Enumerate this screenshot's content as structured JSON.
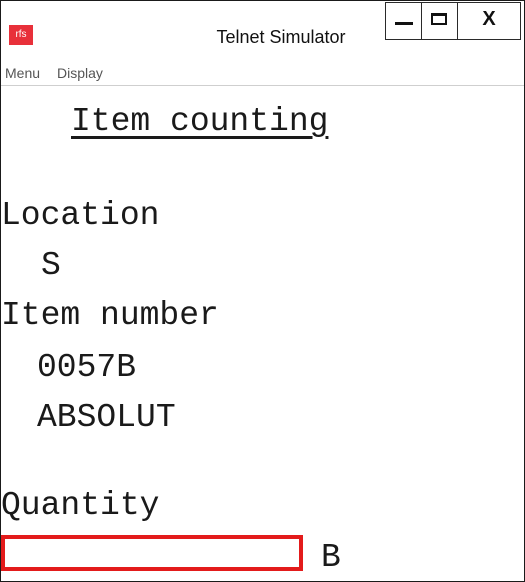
{
  "window": {
    "app_icon_label": "rfs",
    "title": "Telnet Simulator",
    "controls": {
      "minimize": "minimize",
      "maximize": "maximize",
      "close_label": "X"
    }
  },
  "menu": {
    "items": [
      "Menu",
      "Display"
    ]
  },
  "screen": {
    "heading": "Item counting",
    "location_label": "Location",
    "location_value": "S",
    "item_number_label": "Item number",
    "item_number_value": "0057B",
    "item_description": "ABSOLUT",
    "quantity_label": "Quantity",
    "quantity_value": "",
    "quantity_unit": "B"
  },
  "colors": {
    "input_border": "#e31b1b",
    "app_icon_bg": "#e8303a"
  }
}
